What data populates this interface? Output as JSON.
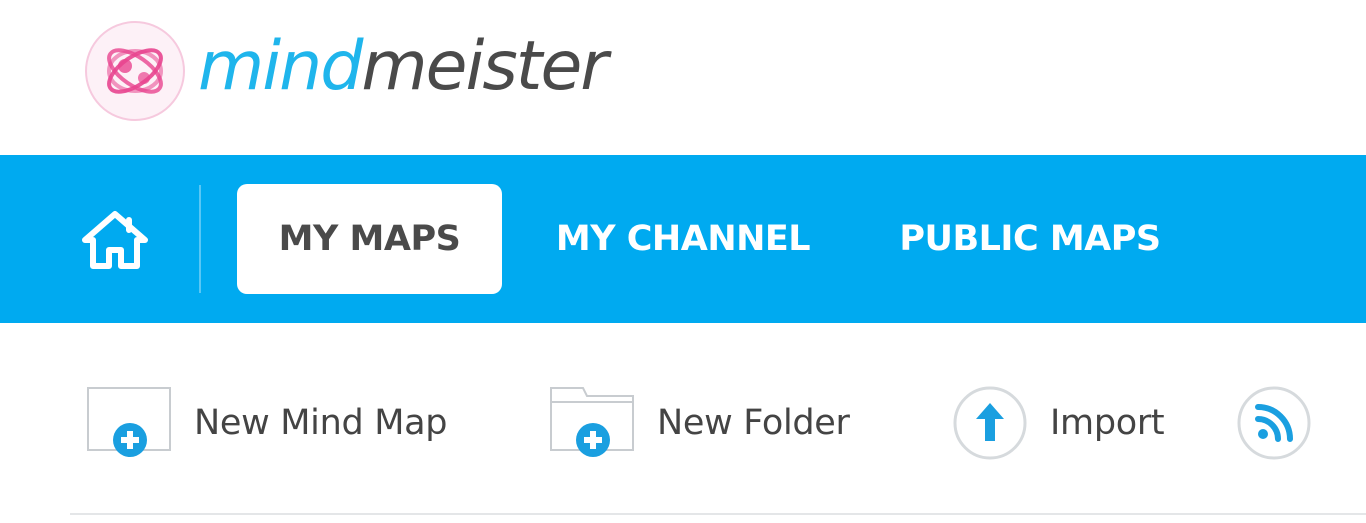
{
  "brand": {
    "name_part1": "mind",
    "name_part2": "meister",
    "accent_color": "#1fb5ec",
    "logo_color": "#e8458f"
  },
  "nav": {
    "background_color": "#00aaf0",
    "home_icon": "home-icon",
    "tabs": [
      {
        "label": "MY MAPS",
        "active": true
      },
      {
        "label": "MY CHANNEL",
        "active": false
      },
      {
        "label": "PUBLIC MAPS",
        "active": false
      }
    ]
  },
  "toolbar": {
    "new_mind_map": {
      "label": "New Mind Map",
      "icon": "new-map-icon"
    },
    "new_folder": {
      "label": "New Folder",
      "icon": "new-folder-icon"
    },
    "import": {
      "label": "Import",
      "icon": "upload-arrow-icon"
    },
    "rss": {
      "icon": "rss-icon"
    }
  }
}
